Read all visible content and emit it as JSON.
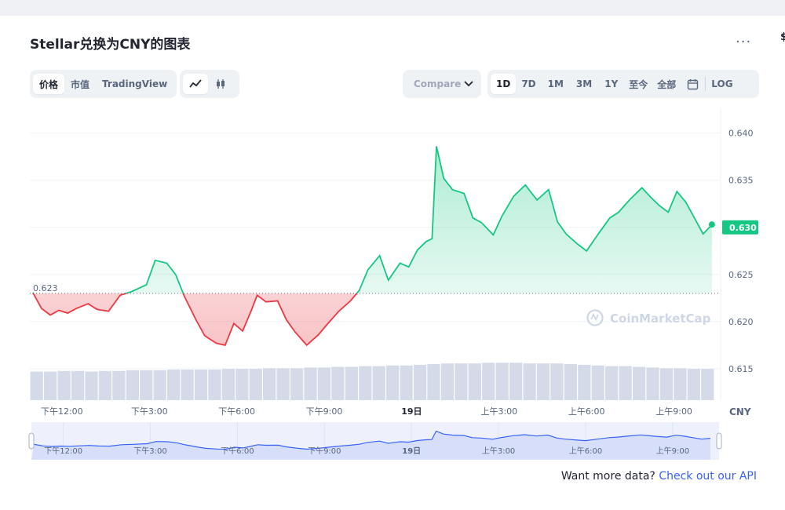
{
  "header": {
    "title": "Stellar兑换为CNY的图表",
    "more_label": "...",
    "edge_label": "$"
  },
  "view_tabs": [
    "价格",
    "市值",
    "TradingView"
  ],
  "chart_type_icons": [
    "line-chart-icon",
    "candlestick-icon"
  ],
  "compare": {
    "label": "Compare"
  },
  "range_tabs": [
    "1D",
    "7D",
    "1M",
    "3M",
    "1Y",
    "至今",
    "全部"
  ],
  "log_label": "LOG",
  "footer": {
    "text": "Want more data?",
    "link": "Check out our API"
  },
  "chart_data": {
    "type": "area",
    "y_ticks": [
      "0.640",
      "0.635",
      "0.630",
      "0.625",
      "0.620",
      "0.615"
    ],
    "ylim": [
      0.6125,
      0.6418
    ],
    "x_ticks": [
      "下午12:00",
      "下午3:00",
      "下午6:00",
      "下午9:00",
      "19日",
      "上午3:00",
      "上午6:00",
      "上午9:00"
    ],
    "x_ticks_hours": [
      12,
      15,
      18,
      21,
      24,
      27,
      30,
      33
    ],
    "xlim": [
      10.9,
      34.6
    ],
    "currency_label": "CNY",
    "reference_value": 0.623,
    "reference_label": "0.623",
    "current_value": 0.63,
    "current_label": "0.630",
    "watermark": "CoinMarketCap",
    "colors": {
      "up": "#16c784",
      "down": "#ea3943",
      "nav_line": "#3861fb",
      "nav_fill": "#e8ecfd"
    },
    "price_points": [
      [
        11.0,
        0.6231
      ],
      [
        11.3,
        0.6214
      ],
      [
        11.6,
        0.6207
      ],
      [
        11.9,
        0.6212
      ],
      [
        12.2,
        0.6209
      ],
      [
        12.5,
        0.6214
      ],
      [
        12.9,
        0.6219
      ],
      [
        13.2,
        0.6213
      ],
      [
        13.6,
        0.6211
      ],
      [
        14.0,
        0.6228
      ],
      [
        14.4,
        0.6232
      ],
      [
        14.9,
        0.6239
      ],
      [
        15.2,
        0.6265
      ],
      [
        15.6,
        0.6262
      ],
      [
        15.9,
        0.625
      ],
      [
        16.2,
        0.6227
      ],
      [
        16.6,
        0.6202
      ],
      [
        16.9,
        0.6185
      ],
      [
        17.3,
        0.6177
      ],
      [
        17.6,
        0.6175
      ],
      [
        17.9,
        0.6198
      ],
      [
        18.2,
        0.619
      ],
      [
        18.5,
        0.6212
      ],
      [
        18.7,
        0.6228
      ],
      [
        19.0,
        0.6221
      ],
      [
        19.4,
        0.6222
      ],
      [
        19.7,
        0.6202
      ],
      [
        20.0,
        0.6189
      ],
      [
        20.4,
        0.6175
      ],
      [
        20.8,
        0.6186
      ],
      [
        21.1,
        0.6197
      ],
      [
        21.5,
        0.6211
      ],
      [
        21.9,
        0.6222
      ],
      [
        22.2,
        0.6233
      ],
      [
        22.5,
        0.6255
      ],
      [
        22.9,
        0.627
      ],
      [
        23.2,
        0.6244
      ],
      [
        23.6,
        0.6262
      ],
      [
        23.9,
        0.6258
      ],
      [
        24.2,
        0.6276
      ],
      [
        24.5,
        0.6285
      ],
      [
        24.7,
        0.6288
      ],
      [
        24.85,
        0.6386
      ],
      [
        25.1,
        0.6352
      ],
      [
        25.4,
        0.634
      ],
      [
        25.8,
        0.6336
      ],
      [
        26.1,
        0.631
      ],
      [
        26.4,
        0.6305
      ],
      [
        26.8,
        0.6292
      ],
      [
        27.1,
        0.6312
      ],
      [
        27.5,
        0.6333
      ],
      [
        27.9,
        0.6345
      ],
      [
        28.3,
        0.6329
      ],
      [
        28.7,
        0.634
      ],
      [
        29.0,
        0.6306
      ],
      [
        29.3,
        0.6293
      ],
      [
        29.7,
        0.6282
      ],
      [
        30.0,
        0.6275
      ],
      [
        30.4,
        0.6293
      ],
      [
        30.8,
        0.631
      ],
      [
        31.1,
        0.6316
      ],
      [
        31.5,
        0.633
      ],
      [
        31.9,
        0.6342
      ],
      [
        32.2,
        0.6332
      ],
      [
        32.5,
        0.6323
      ],
      [
        32.8,
        0.6316
      ],
      [
        33.1,
        0.6338
      ],
      [
        33.4,
        0.6327
      ],
      [
        33.7,
        0.631
      ],
      [
        34.0,
        0.6293
      ],
      [
        34.3,
        0.6303
      ]
    ],
    "volume_values": [
      42,
      42,
      43,
      43,
      42,
      43,
      43,
      44,
      44,
      44,
      45,
      45,
      45,
      45,
      46,
      46,
      46,
      47,
      47,
      47,
      48,
      48,
      49,
      49,
      50,
      50,
      51,
      51,
      52,
      53,
      54,
      54,
      54,
      55,
      55,
      55,
      54,
      54,
      54,
      53,
      52,
      51,
      50,
      50,
      49,
      48,
      47,
      47,
      46,
      46
    ]
  },
  "navigator": {
    "labels": [
      "下午12:00",
      "下午3:00",
      "下午6:00",
      "下午9:00",
      "19日",
      "上午3:00",
      "上午6:00",
      "上午9:00"
    ]
  }
}
